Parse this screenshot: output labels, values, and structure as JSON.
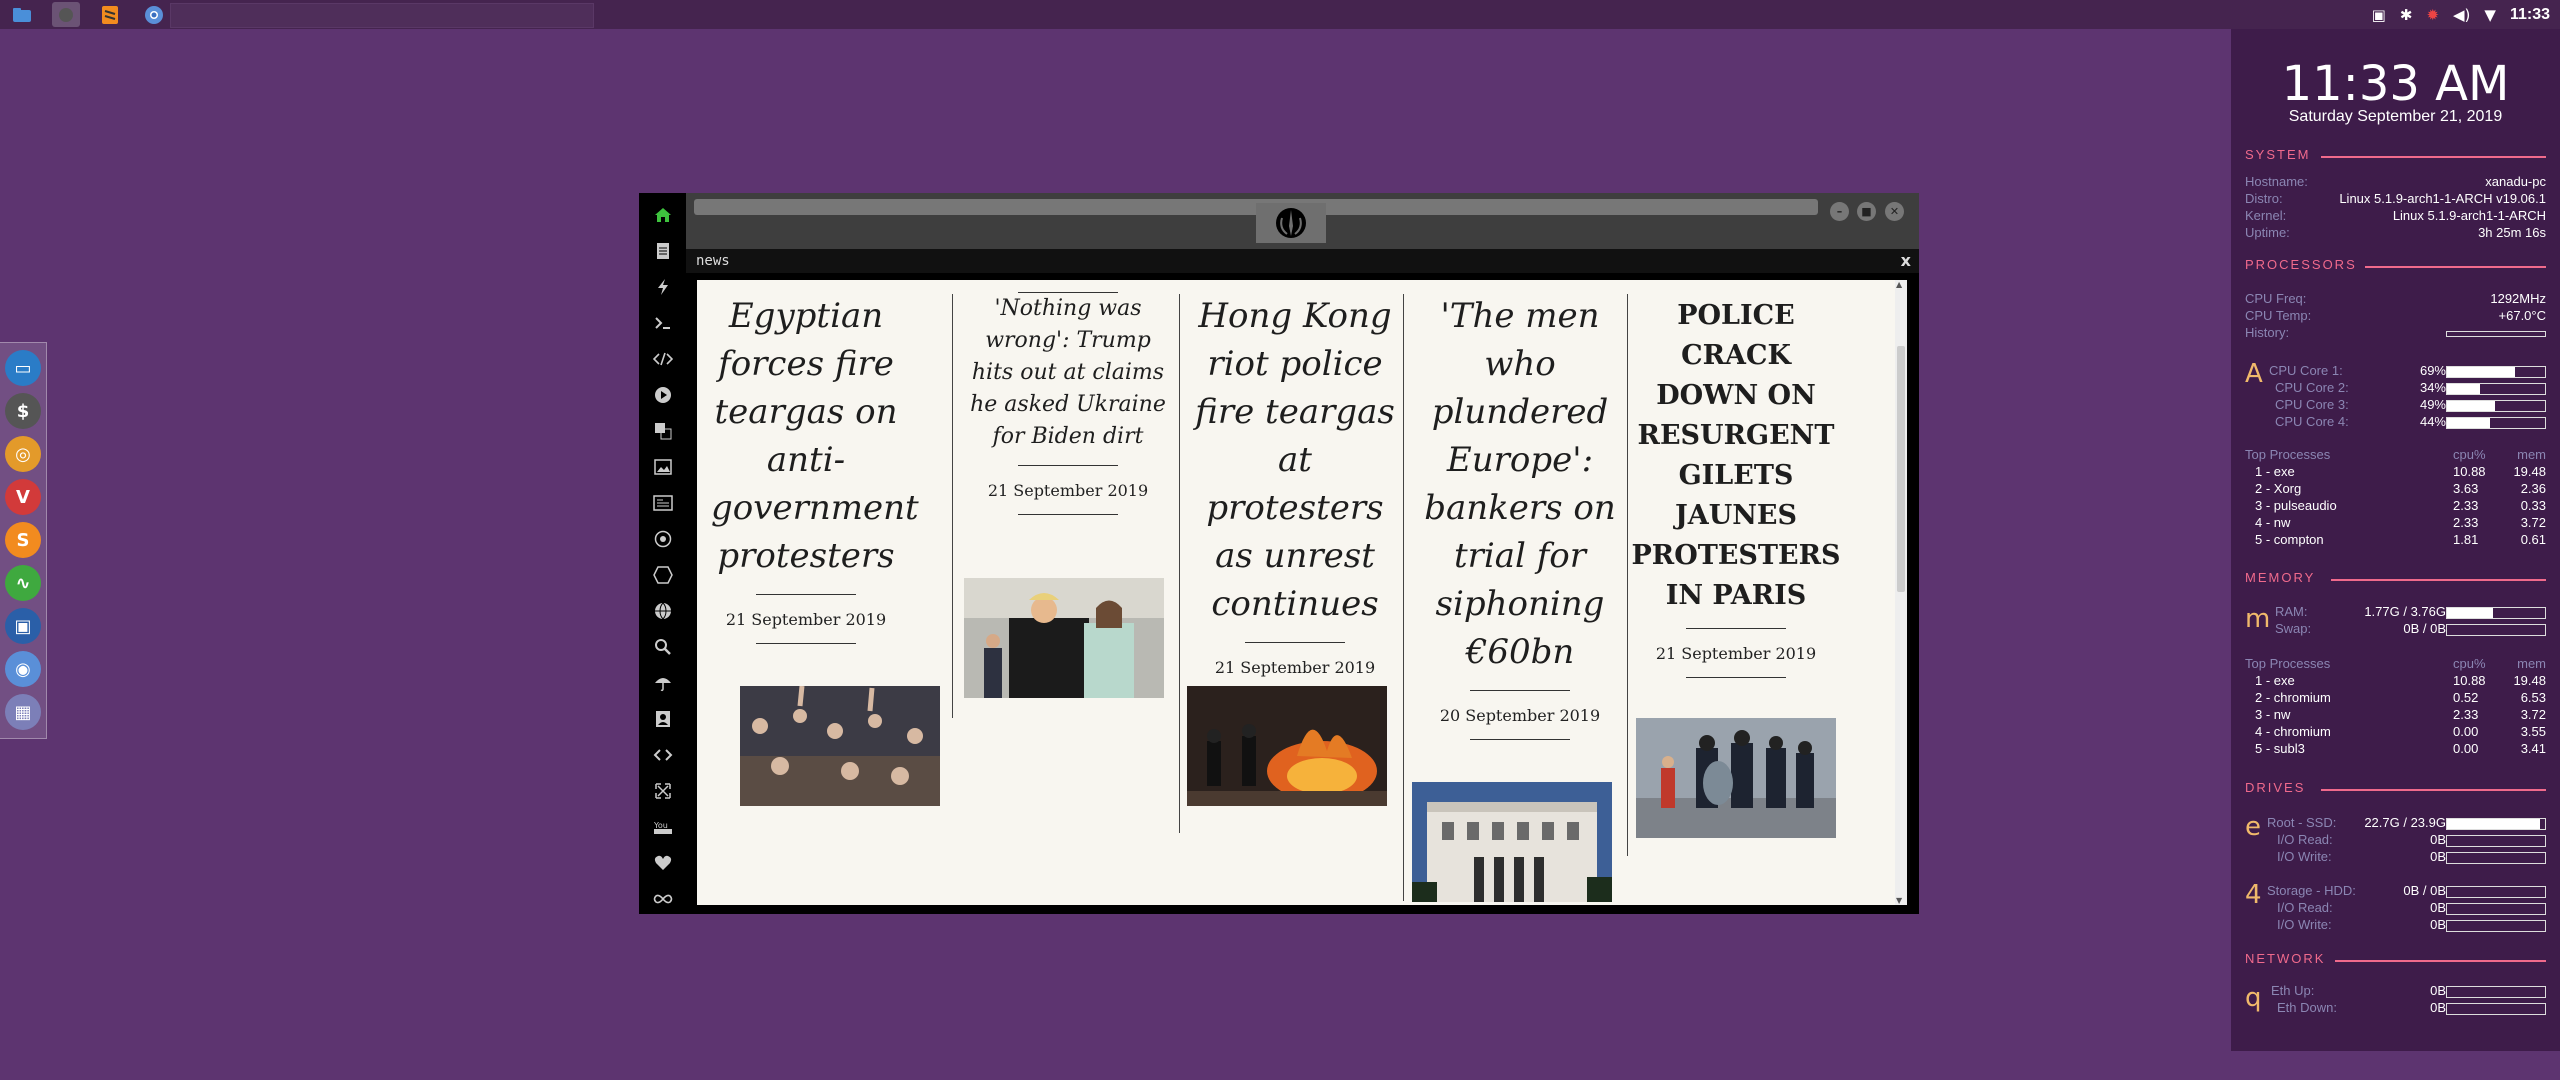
{
  "taskbar": {
    "apps": [
      "files-icon",
      "app-icon",
      "sublime-icon",
      "chromium-icon"
    ],
    "tray": {
      "clock": "11:33"
    }
  },
  "dock": {
    "items": [
      {
        "name": "files-icon",
        "color": "#2a7cc7",
        "glyph": "▭"
      },
      {
        "name": "money-icon",
        "color": "#555",
        "glyph": "$"
      },
      {
        "name": "ubuntu-icon",
        "color": "#e39a2a",
        "glyph": "◎"
      },
      {
        "name": "vivaldi-icon",
        "color": "#d23a3a",
        "glyph": "V"
      },
      {
        "name": "sublime-icon",
        "color": "#f28b1f",
        "glyph": "S"
      },
      {
        "name": "monitor-icon",
        "color": "#3fa93f",
        "glyph": "∿"
      },
      {
        "name": "screenshot-icon",
        "color": "#2a5fa8",
        "glyph": "▣"
      },
      {
        "name": "chrome-icon",
        "color": "#5a8fd8",
        "glyph": "◉"
      },
      {
        "name": "grid-icon",
        "color": "#7c7fb8",
        "glyph": "▦"
      }
    ]
  },
  "window": {
    "tab_label": "news",
    "close_label": "x",
    "articles": [
      {
        "title": "Egyptian forces fire teargas on anti-government protesters",
        "date": "21 September 2019"
      },
      {
        "title": "'Nothing was wrong': Trump hits out at claims he asked Ukraine for Biden dirt",
        "date": "21 September 2019"
      },
      {
        "title": "Hong Kong riot police fire teargas at protesters as unrest continues",
        "date": "21 September 2019"
      },
      {
        "title": "'The men who plundered Europe': bankers on trial for siphoning €60bn",
        "date": "20 September 2019"
      },
      {
        "title": "POLICE CRACK DOWN ON RESURGENT GILETS JAUNES PROTESTERS IN PARIS",
        "date": "21 September 2019"
      }
    ]
  },
  "conky": {
    "time": "11:33 AM",
    "date": "Saturday September 21, 2019",
    "system": {
      "heading": "SYSTEM",
      "rows": [
        {
          "k": "Hostname:",
          "v": "xanadu-pc"
        },
        {
          "k": "Distro:",
          "v": "Linux 5.1.9-arch1-1-ARCH v19.06.1"
        },
        {
          "k": "Kernel:",
          "v": "Linux 5.1.9-arch1-1-ARCH"
        },
        {
          "k": "Uptime:",
          "v": "3h 25m 16s"
        }
      ]
    },
    "processors": {
      "heading": "PROCESSORS",
      "rows": [
        {
          "k": "CPU Freq:",
          "v": "1292MHz"
        },
        {
          "k": "CPU Temp:",
          "v": "+67.0°C"
        },
        {
          "k": "History:",
          "v": ""
        }
      ],
      "letter": "A",
      "cores": [
        {
          "k": "CPU Core 1:",
          "v": "69%",
          "pct": 0.69
        },
        {
          "k": "CPU Core 2:",
          "v": "34%",
          "pct": 0.34
        },
        {
          "k": "CPU Core 3:",
          "v": "49%",
          "pct": 0.49
        },
        {
          "k": "CPU Core 4:",
          "v": "44%",
          "pct": 0.44
        }
      ],
      "top_label": "Top Processes",
      "cpu_label": "cpu%",
      "mem_label": "mem",
      "top": [
        {
          "n": "1 - exe",
          "c": "10.88",
          "m": "19.48"
        },
        {
          "n": "2 - Xorg",
          "c": "3.63",
          "m": "2.36"
        },
        {
          "n": "3 - pulseaudio",
          "c": "2.33",
          "m": "0.33"
        },
        {
          "n": "4 - nw",
          "c": "2.33",
          "m": "3.72"
        },
        {
          "n": "5 - compton",
          "c": "1.81",
          "m": "0.61"
        }
      ]
    },
    "memory": {
      "heading": "MEMORY",
      "letter": "m",
      "rows": [
        {
          "k": "RAM:",
          "v": "1.77G / 3.76G",
          "pct": 0.47
        },
        {
          "k": "Swap:",
          "v": "0B / 0B",
          "pct": 0
        }
      ],
      "top_label": "Top Processes",
      "cpu_label": "cpu%",
      "mem_label": "mem",
      "top": [
        {
          "n": "1 - exe",
          "c": "10.88",
          "m": "19.48"
        },
        {
          "n": "2 - chromium",
          "c": "0.52",
          "m": "6.53"
        },
        {
          "n": "3 - nw",
          "c": "2.33",
          "m": "3.72"
        },
        {
          "n": "4 - chromium",
          "c": "0.00",
          "m": "3.55"
        },
        {
          "n": "5 - subl3",
          "c": "0.00",
          "m": "3.41"
        }
      ]
    },
    "drives": {
      "heading": "DRIVES",
      "root": {
        "letter": "e",
        "rows": [
          {
            "k": "Root - SSD:",
            "v": "22.7G / 23.9G",
            "pct": 0.95
          },
          {
            "k": "I/O Read:",
            "v": "0B",
            "pct": 0
          },
          {
            "k": "I/O Write:",
            "v": "0B",
            "pct": 0
          }
        ]
      },
      "storage": {
        "letter": "4",
        "rows": [
          {
            "k": "Storage - HDD:",
            "v": "0B / 0B",
            "pct": 0
          },
          {
            "k": "I/O Read:",
            "v": "0B",
            "pct": 0
          },
          {
            "k": "I/O Write:",
            "v": "0B",
            "pct": 0
          }
        ]
      }
    },
    "network": {
      "heading": "NETWORK",
      "letter": "q",
      "rows": [
        {
          "k": "Eth Up:",
          "v": "0B",
          "pct": 0
        },
        {
          "k": "Eth Down:",
          "v": "0B",
          "pct": 0
        }
      ]
    }
  }
}
